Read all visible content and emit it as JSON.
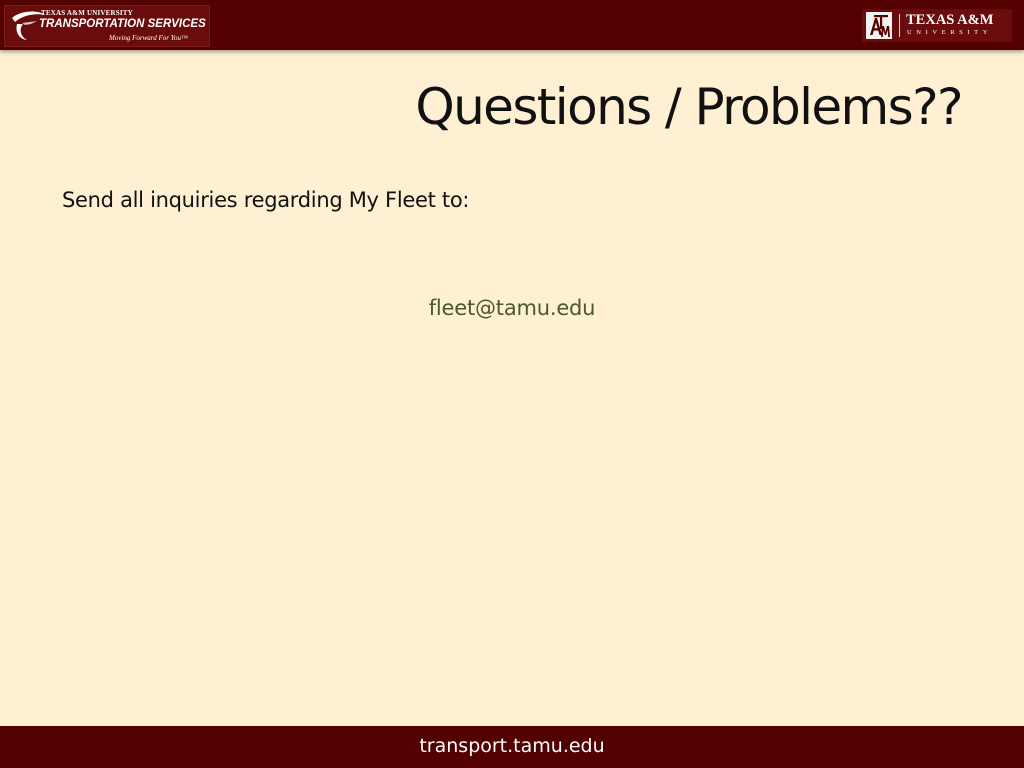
{
  "header": {
    "transportation_logo": {
      "university": "TEXAS A&M UNIVERSITY",
      "name": "TRANSPORTATION SERVICES",
      "tagline": "Moving Forward For You™"
    },
    "university_logo": {
      "name": "TEXAS A&M",
      "subtitle": "UNIVERSITY"
    }
  },
  "slide": {
    "title": "Questions / Problems??",
    "body": "Send all inquiries regarding My Fleet to:",
    "email": "fleet@tamu.edu"
  },
  "footer": {
    "url": "transport.tamu.edu"
  },
  "colors": {
    "maroon": "#520000",
    "background": "#FFF0D4",
    "link": "#4a5a28"
  }
}
